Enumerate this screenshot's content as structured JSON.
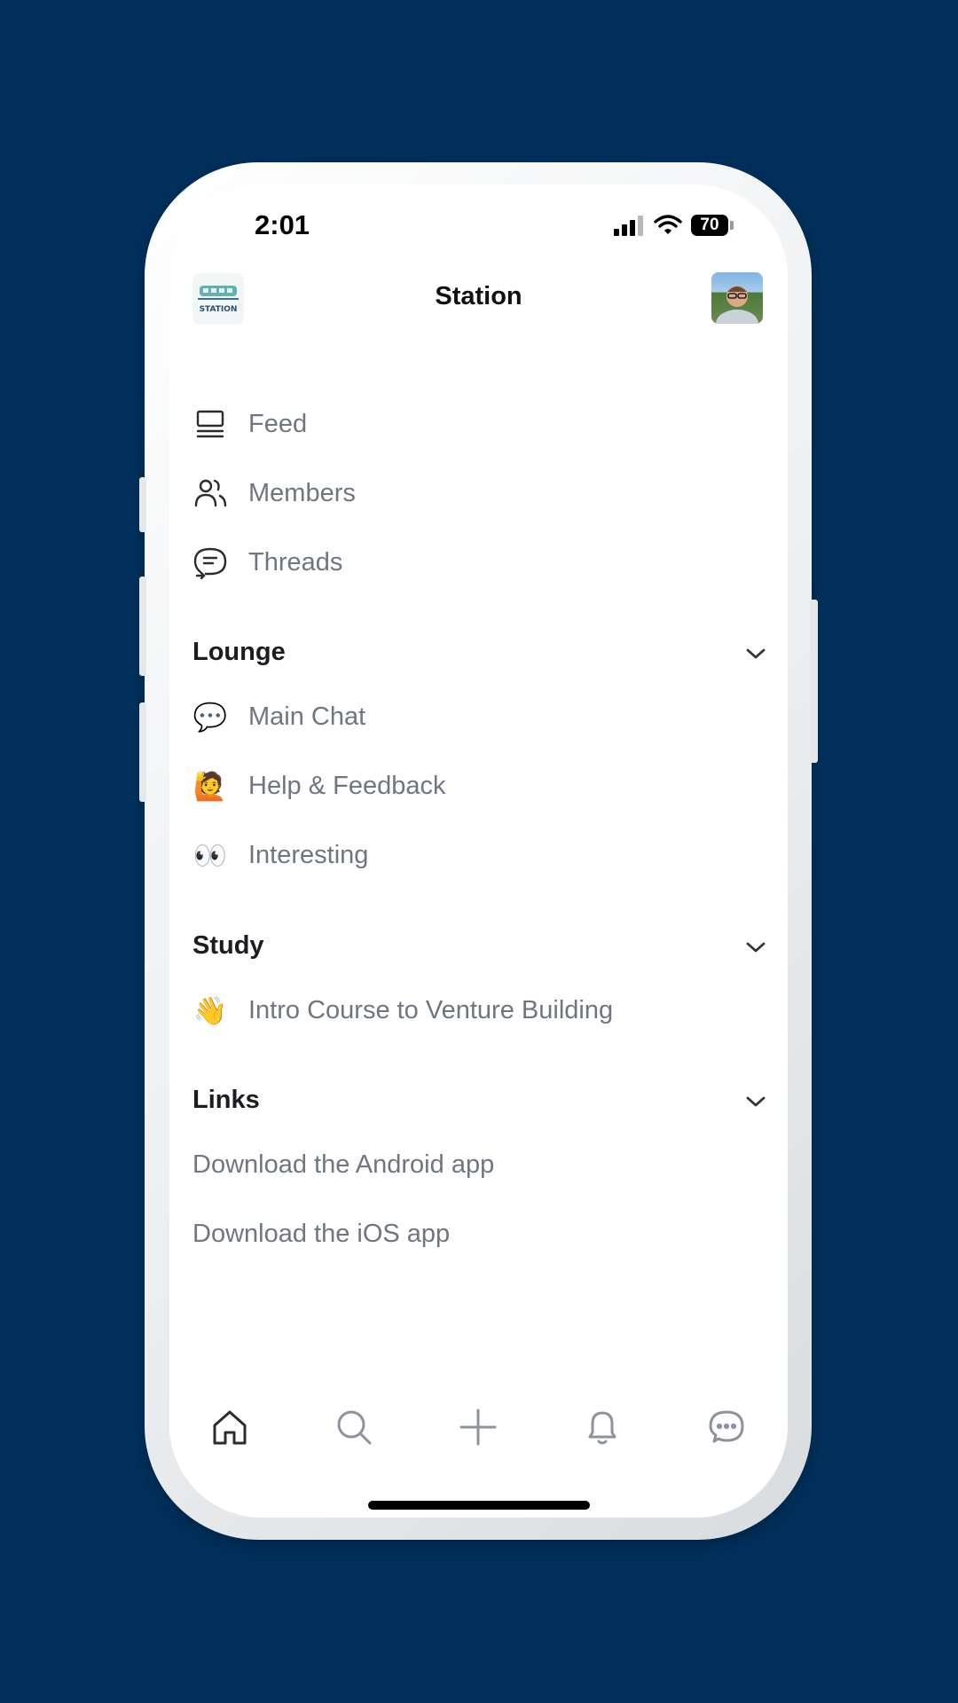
{
  "status_bar": {
    "time": "2:01",
    "battery": "70"
  },
  "header": {
    "title": "Station",
    "logo_text": "STATION"
  },
  "nav": [
    {
      "label": "Feed",
      "icon": "feed-icon"
    },
    {
      "label": "Members",
      "icon": "members-icon"
    },
    {
      "label": "Threads",
      "icon": "threads-icon"
    }
  ],
  "sections": {
    "lounge": {
      "title": "Lounge",
      "items": [
        {
          "emoji": "💬",
          "label": "Main Chat"
        },
        {
          "emoji": "🙋",
          "label": "Help & Feedback"
        },
        {
          "emoji": "👀",
          "label": "Interesting"
        }
      ]
    },
    "study": {
      "title": "Study",
      "items": [
        {
          "emoji": "👋",
          "label": "Intro Course to Venture Building"
        }
      ]
    },
    "links": {
      "title": "Links",
      "items": [
        {
          "label": "Download the Android app"
        },
        {
          "label": "Download the iOS app"
        }
      ]
    }
  },
  "tab_bar": [
    "home-icon",
    "search-icon",
    "plus-icon",
    "bell-icon",
    "chat-icon"
  ],
  "colors": {
    "background": "#01305c",
    "text_muted": "#707680",
    "text_strong": "#1c1d20"
  }
}
